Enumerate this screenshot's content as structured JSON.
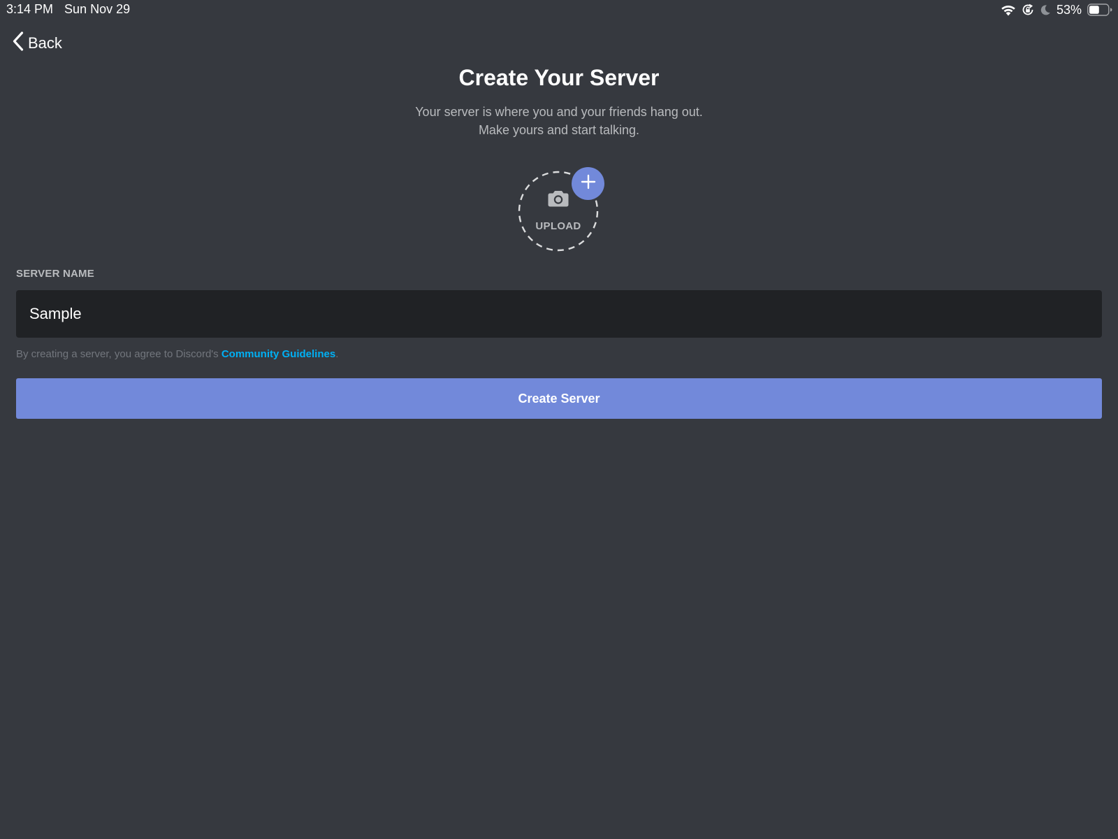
{
  "status_bar": {
    "time": "3:14 PM",
    "date": "Sun Nov 29",
    "battery_percent": "53%",
    "battery_level": 0.53,
    "icons": [
      "wifi-icon",
      "orientation-lock-icon",
      "moon-icon",
      "battery-icon"
    ]
  },
  "nav": {
    "back_label": "Back"
  },
  "header": {
    "title": "Create Your Server",
    "subtitle_line1": "Your server is where you and your friends hang out.",
    "subtitle_line2": "Make yours and start talking."
  },
  "upload": {
    "label": "UPLOAD",
    "icons": [
      "camera-icon",
      "plus-icon"
    ]
  },
  "form": {
    "server_name_label": "SERVER NAME",
    "server_name_value": "Sample",
    "terms_text": "By creating a server, you agree to Discord's ",
    "terms_link": "Community Guidelines",
    "terms_end": ".",
    "create_button": "Create Server"
  },
  "colors": {
    "background": "#36393f",
    "input_background": "#202225",
    "accent": "#7289da",
    "link": "#00b0f4",
    "muted_text": "#b9bbbe",
    "faint_text": "#72767d"
  }
}
